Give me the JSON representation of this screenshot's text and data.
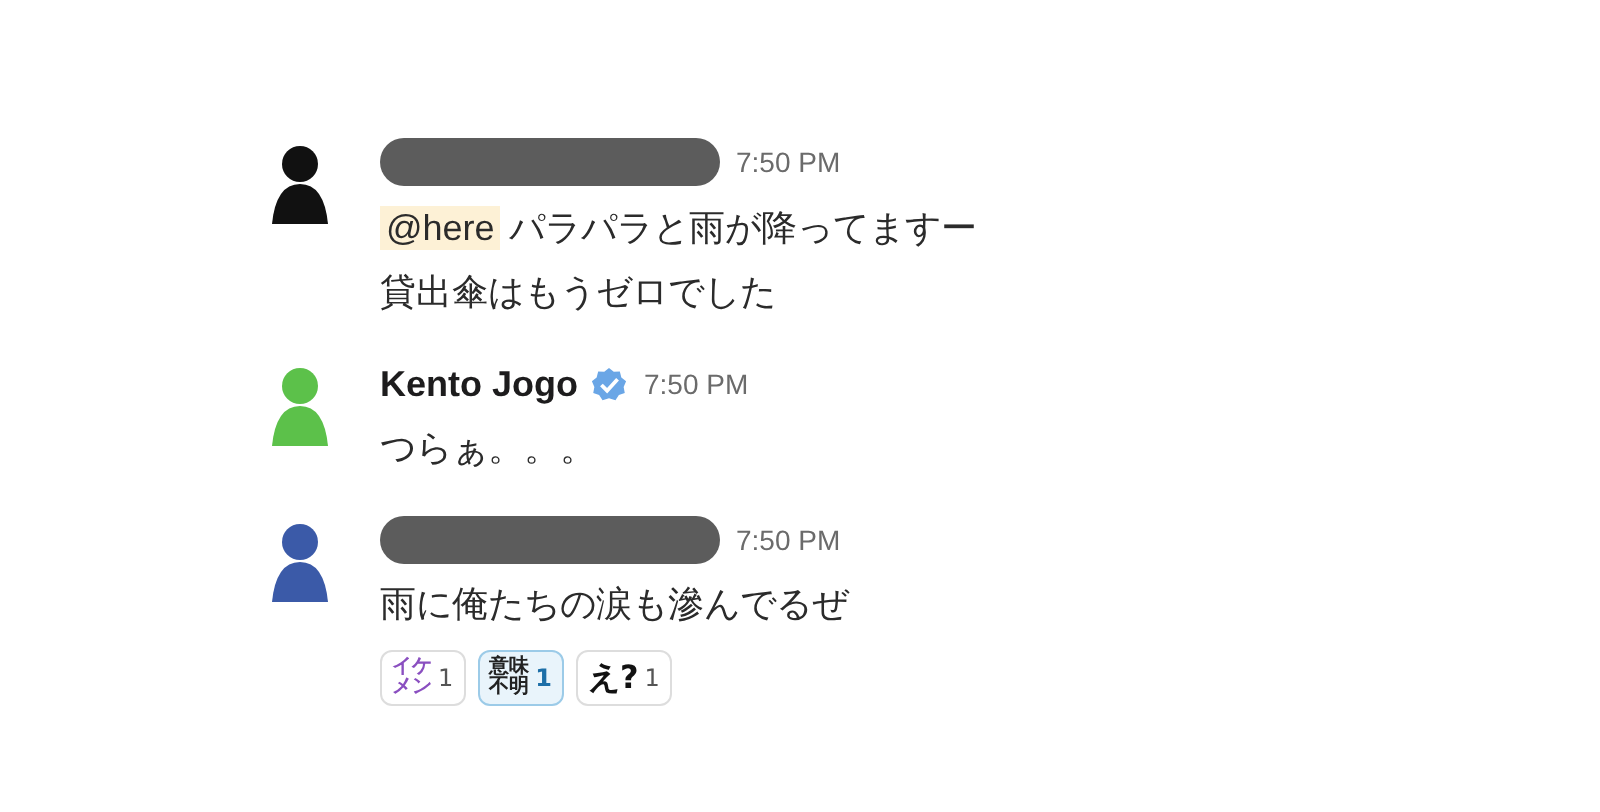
{
  "messages": [
    {
      "avatar": {
        "color": "#111111"
      },
      "sender": {
        "redacted": true
      },
      "time": "7:50 PM",
      "mention": "@here",
      "lines": [
        "パラパラと雨が降ってますー",
        "貸出傘はもうゼロでした"
      ]
    },
    {
      "avatar": {
        "color": "#5cc14a"
      },
      "sender": {
        "redacted": false,
        "name": "Kento Jogo",
        "verified": true
      },
      "time": "7:50 PM",
      "lines": [
        "つらぁ。。。"
      ]
    },
    {
      "avatar": {
        "color": "#3b5aa8"
      },
      "sender": {
        "redacted": true
      },
      "time": "7:50 PM",
      "lines": [
        "雨に俺たちの涙も滲んでるぜ"
      ],
      "reactions": [
        {
          "emoji": [
            "イケ",
            "メン"
          ],
          "color": "#8a4fc0",
          "count": "1",
          "selected": false
        },
        {
          "emoji": [
            "意味",
            "不明"
          ],
          "color": "#222222",
          "count": "1",
          "selected": true
        },
        {
          "emoji": [
            "え?"
          ],
          "color": "#111111",
          "count": "1",
          "selected": false
        }
      ]
    }
  ]
}
